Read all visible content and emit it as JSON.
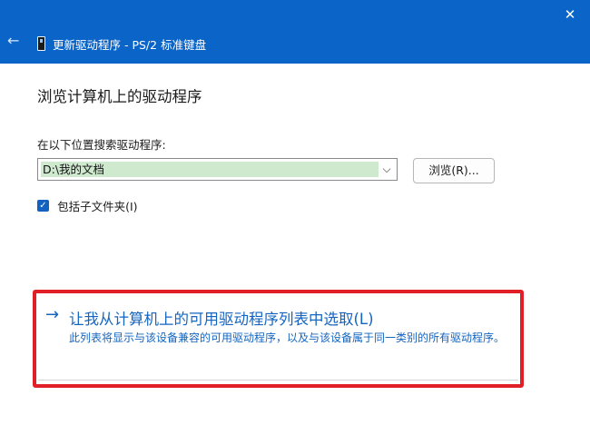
{
  "window": {
    "title": "更新驱动程序 - PS/2 标准键盘",
    "close_glyph": "✕",
    "back_glyph": "←",
    "icons": {
      "back": "back-arrow-icon",
      "device": "keyboard-device-icon",
      "close": "close-icon"
    }
  },
  "page": {
    "heading": "浏览计算机上的驱动程序",
    "location_label": "在以下位置搜索驱动程序:",
    "path_value": "D:\\我的文档",
    "dropdown_glyph": "⌵",
    "browse_label": "浏览(R)...",
    "include_subfolders": {
      "label": "包括子文件夹(I)",
      "checked": true,
      "check_glyph": "✓"
    }
  },
  "pick_option": {
    "arrow_glyph": "→",
    "title": "让我从计算机上的可用驱动程序列表中选取(L)",
    "description": "此列表将显示与该设备兼容的可用驱动程序，以及与该设备属于同一类别的所有驱动程序。",
    "highlight_color": "#e02026"
  },
  "colors": {
    "title_bar": "#0b64c8",
    "link": "#1565c0",
    "path_highlight": "#cfe9cf",
    "checkbox": "#1462c0"
  }
}
